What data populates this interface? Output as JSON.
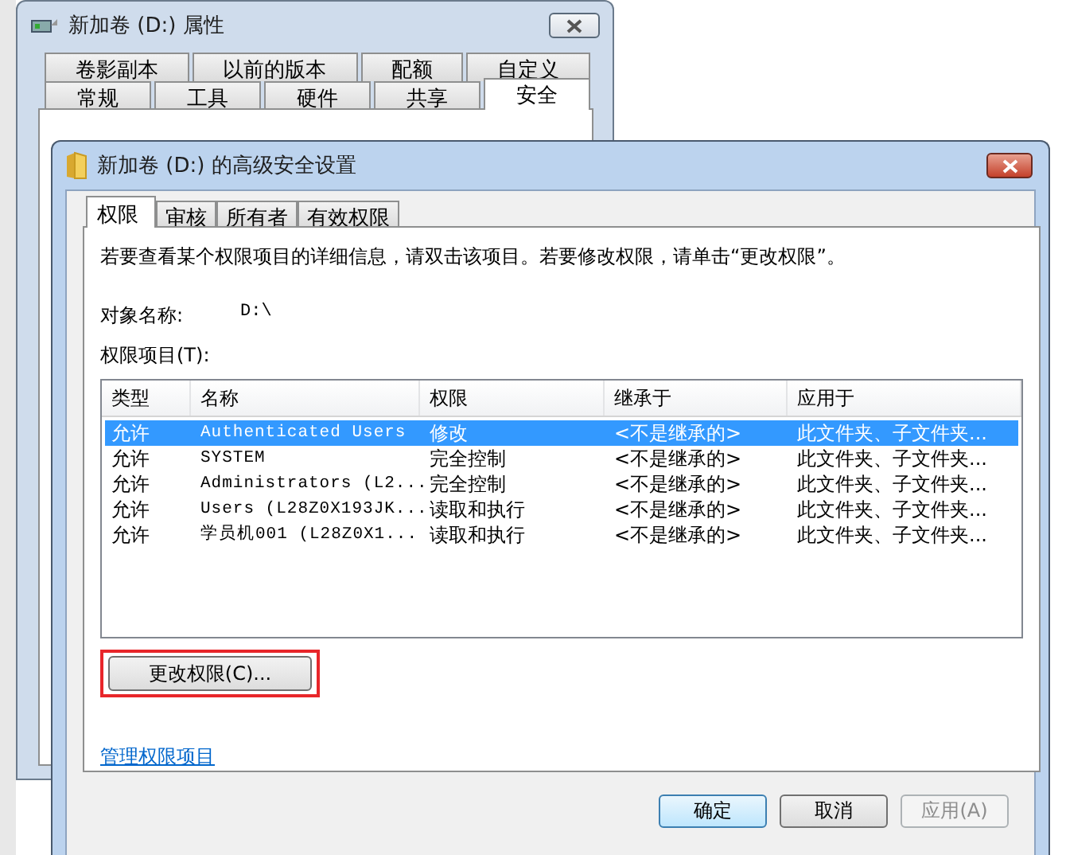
{
  "background_window": {
    "title": "新加卷 (D:) 属性",
    "tab_rows": [
      [
        {
          "label": "卷影副本",
          "selected": false
        },
        {
          "label": "以前的版本",
          "selected": false
        },
        {
          "label": "配额",
          "selected": false
        },
        {
          "label": "自定义",
          "selected": false
        }
      ],
      [
        {
          "label": "常规",
          "selected": false
        },
        {
          "label": "工具",
          "selected": false
        },
        {
          "label": "硬件",
          "selected": false
        },
        {
          "label": "共享",
          "selected": false
        },
        {
          "label": "安全",
          "selected": true
        }
      ]
    ]
  },
  "dialog": {
    "title": "新加卷 (D:) 的高级安全设置",
    "tabs": [
      {
        "label": "权限",
        "selected": true
      },
      {
        "label": "审核",
        "selected": false
      },
      {
        "label": "所有者",
        "selected": false
      },
      {
        "label": "有效权限",
        "selected": false
      }
    ],
    "info": "若要查看某个权限项目的详细信息，请双击该项目。若要修改权限，请单击“更改权限”。",
    "object_name_label": "对象名称:",
    "object_name": "D:\\",
    "entries_label": "权限项目(T):",
    "table": {
      "columns": [
        "类型",
        "名称",
        "权限",
        "继承于",
        "应用于"
      ],
      "rows": [
        {
          "cells": [
            "允许",
            "Authenticated Users",
            "修改",
            "<不是继承的>",
            "此文件夹、子文件夹..."
          ],
          "selected": true
        },
        {
          "cells": [
            "允许",
            "SYSTEM",
            "完全控制",
            "<不是继承的>",
            "此文件夹、子文件夹..."
          ],
          "selected": false
        },
        {
          "cells": [
            "允许",
            "Administrators (L2...",
            "完全控制",
            "<不是继承的>",
            "此文件夹、子文件夹..."
          ],
          "selected": false
        },
        {
          "cells": [
            "允许",
            "Users (L28Z0X193JK...",
            "读取和执行",
            "<不是继承的>",
            "此文件夹、子文件夹..."
          ],
          "selected": false
        },
        {
          "cells": [
            "允许",
            "学员机001 (L28Z0X1...",
            "读取和执行",
            "<不是继承的>",
            "此文件夹、子文件夹..."
          ],
          "selected": false
        }
      ]
    },
    "change_button": {
      "label": "更改权限(C)...",
      "highlighted": true
    },
    "manage_link": "管理权限项目",
    "buttons": [
      {
        "label": "确定",
        "default": true,
        "disabled": false
      },
      {
        "label": "取消",
        "default": false,
        "disabled": false
      },
      {
        "label": "应用(A)",
        "default": false,
        "disabled": true
      }
    ]
  }
}
